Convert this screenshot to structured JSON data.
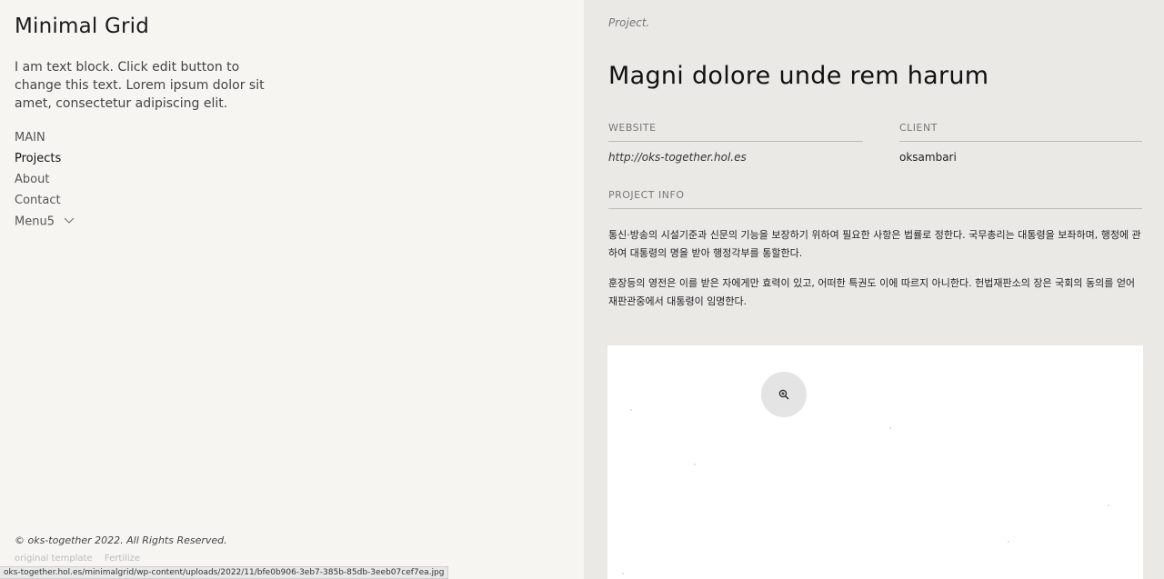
{
  "sidebar": {
    "site_title": "Minimal Grid",
    "intro": "I am text block. Click edit button to change this text. Lorem ipsum dolor sit amet, consectetur adipiscing elit.",
    "nav": [
      {
        "label": "MAIN",
        "active": false
      },
      {
        "label": "Projects",
        "active": true
      },
      {
        "label": "About",
        "active": false
      },
      {
        "label": "Contact",
        "active": false
      },
      {
        "label": "Menu5",
        "active": false,
        "has_submenu": true
      }
    ],
    "footer_copyright": "© oks-together 2022. All Rights Reserved.",
    "footer_credit": [
      "original template",
      "Fertilize"
    ]
  },
  "status_bar": {
    "url": "oks-together.hol.es/minimalgrid/wp-content/uploads/2022/11/bfe0b906-3eb7-385b-85db-3eeb07cef7ea.jpg"
  },
  "project": {
    "kicker": "Project.",
    "title": "Magni dolore unde rem harum",
    "website_label": "WEBSITE",
    "website_value": "http://oks-together.hol.es",
    "client_label": "CLIENT",
    "client_value": "oksambari",
    "info_label": "PROJECT INFO",
    "paragraphs": [
      "통신·방송의 시설기준과 신문의 기능을 보장하기 위하여 필요한 사항은 법률로 정한다. 국무총리는 대통령을 보좌하며, 행정에 관하여 대통령의 명을 받아 행정각부를 통할한다.",
      "훈장등의 영전은 이를 받은 자에게만 효력이 있고, 어떠한 특권도 이에 따르지 아니한다. 헌법재판소의 장은 국회의 동의를 얻어 재판관중에서 대통령이 임명한다."
    ]
  },
  "icons": {
    "zoom": "zoom-in-icon",
    "menu_chevron": "chevron-down-icon"
  },
  "colors": {
    "left_bg": "#f6f5f2",
    "right_bg": "#ebe9e6"
  }
}
